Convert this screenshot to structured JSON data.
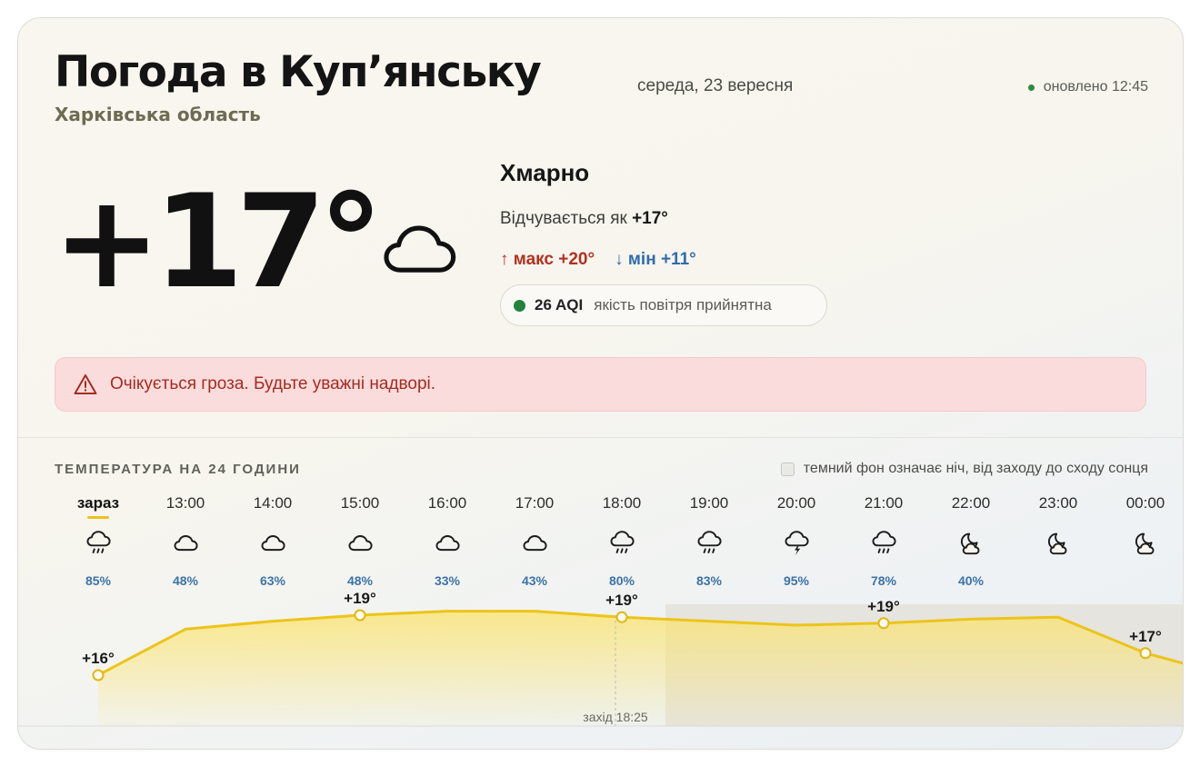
{
  "header": {
    "title": "Погода в Куп’янську",
    "date": "середа, 23 вересня",
    "region": "Харківська область",
    "updated": "оновлено 12:45"
  },
  "current": {
    "temp": "+17°",
    "condition": "Хмарно",
    "condition_icon": "cloud-icon",
    "feels_like_label": "Відчувається як",
    "feels_like_value": "+17°",
    "max": "↑ макс +20°",
    "min": "↓ мін +11°",
    "aqi_value": "26 AQI",
    "aqi_text": "якість повітря прийнятна",
    "aqi_color": "#22813a"
  },
  "alert": {
    "text": "Очікується гроза. Будьте уважні надворі.",
    "icon": "warning-icon"
  },
  "forecast": {
    "title": "ТЕМПЕРАТУРА НА 24 ГОДИНИ",
    "legend": "темний фон означає ніч, від заходу до сходу сонця",
    "sunset": "захід 18:25",
    "hours": [
      {
        "time": "зараз",
        "icon": "rain",
        "prob": "85%"
      },
      {
        "time": "13:00",
        "icon": "cloud",
        "prob": "48%"
      },
      {
        "time": "14:00",
        "icon": "cloud",
        "prob": "63%"
      },
      {
        "time": "15:00",
        "icon": "cloud",
        "prob": "48%"
      },
      {
        "time": "16:00",
        "icon": "cloud",
        "prob": "33%"
      },
      {
        "time": "17:00",
        "icon": "cloud",
        "prob": "43%"
      },
      {
        "time": "18:00",
        "icon": "rain",
        "prob": "80%"
      },
      {
        "time": "19:00",
        "icon": "rain",
        "prob": "83%"
      },
      {
        "time": "20:00",
        "icon": "thunder",
        "prob": "95%"
      },
      {
        "time": "21:00",
        "icon": "rain",
        "prob": "78%"
      },
      {
        "time": "22:00",
        "icon": "moon-cloud",
        "prob": "40%"
      },
      {
        "time": "23:00",
        "icon": "moon-cloud",
        "prob": ""
      },
      {
        "time": "00:00",
        "icon": "moon-cloud",
        "prob": ""
      }
    ]
  },
  "chart_data": {
    "type": "area",
    "x": [
      "зараз",
      "13:00",
      "14:00",
      "15:00",
      "16:00",
      "17:00",
      "18:00",
      "19:00",
      "20:00",
      "21:00",
      "22:00",
      "23:00",
      "00:00"
    ],
    "values": [
      16,
      18.3,
      18.7,
      19,
      19.2,
      19.2,
      18.9,
      18.7,
      18.5,
      18.6,
      18.8,
      18.9,
      17.1
    ],
    "labels": [
      "+16°",
      "",
      "",
      "+19°",
      "",
      "",
      "+19°",
      "",
      "",
      "+19°",
      "",
      "",
      "+17°"
    ],
    "colors": {
      "line": "#ecc41a",
      "fill": "#fbe36a",
      "night": "#e6e4de"
    }
  }
}
